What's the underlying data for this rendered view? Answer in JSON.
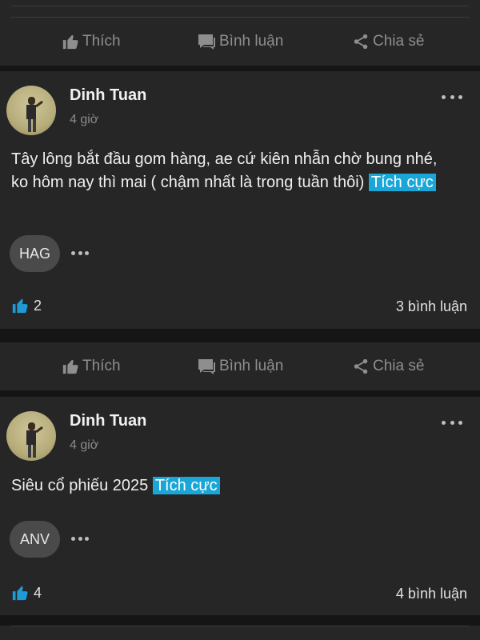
{
  "actions": {
    "like_label": "Thích",
    "comment_label": "Bình luận",
    "share_label": "Chia sẻ"
  },
  "posts": [
    {
      "author": "Dinh Tuan",
      "time": "4 giờ",
      "text": "Tây lông bắt đầu gom hàng, ae cứ kiên nhẫn chờ bung nhé, ko hôm nay thì mai ( chậm nhất là trong tuần thôi)",
      "sentiment": "Tích cực",
      "ticker": "HAG",
      "likes": "2",
      "comments": "3 bình luận"
    },
    {
      "author": "Dinh Tuan",
      "time": "4 giờ",
      "text": "Siêu cổ phiếu 2025",
      "sentiment": "Tích cực",
      "ticker": "ANV",
      "likes": "4",
      "comments": "4 bình luận"
    }
  ],
  "colors": {
    "background": "#151515",
    "card": "#262626",
    "sentiment_badge": "#1aa6d6",
    "like_icon": "#1e9bd6",
    "muted_text": "#8e8e8e"
  },
  "icons": [
    "thumbs-up-icon",
    "comment-icon",
    "share-icon",
    "more-dots-icon"
  ]
}
